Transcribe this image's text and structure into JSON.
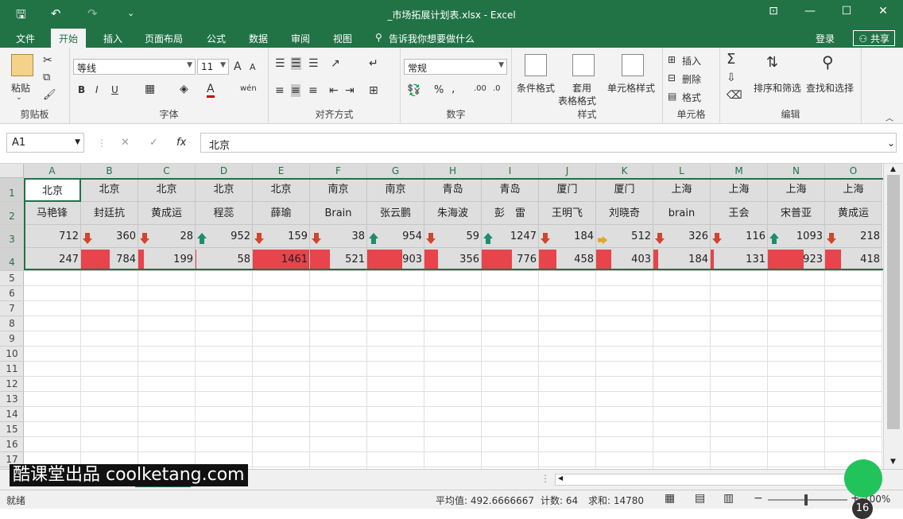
{
  "titlebar": {
    "title": "_市场拓展计划表.xlsx - Excel",
    "save": "🖫",
    "undo": "↶",
    "redo": "↷",
    "more": "⌄",
    "ribbon_opts": "⊡",
    "minimize": "—",
    "restore": "☐",
    "close": "✕"
  },
  "tabs": [
    {
      "label": "文件"
    },
    {
      "label": "开始"
    },
    {
      "label": "插入"
    },
    {
      "label": "页面布局"
    },
    {
      "label": "公式"
    },
    {
      "label": "数据"
    },
    {
      "label": "审阅"
    },
    {
      "label": "视图"
    },
    {
      "label": "告诉我你想要做什么"
    }
  ],
  "account": {
    "login": "登录",
    "share": "共享"
  },
  "ribbon": {
    "clipboard": {
      "label": "剪贴板",
      "paste": "粘贴"
    },
    "font": {
      "label": "字体",
      "name": "等线",
      "size": "11",
      "bold": "B",
      "italic": "I",
      "underline": "U",
      "grow": "A",
      "shrink": "A",
      "wen": "wén"
    },
    "align": {
      "label": "对齐方式"
    },
    "number": {
      "label": "数字",
      "format": "常规",
      "percent": "%",
      "comma": ","
    },
    "styles": {
      "label": "样式",
      "cond": "条件格式",
      "table1": "套用",
      "table2": "表格格式",
      "cell": "单元格样式"
    },
    "cells": {
      "label": "单元格",
      "insert": "插入",
      "delete": "删除",
      "format": "格式"
    },
    "edit": {
      "label": "编辑",
      "sort": "排序和筛选",
      "find": "查找和选择"
    }
  },
  "formula_bar": {
    "namebox": "A1",
    "cancel": "✕",
    "confirm": "✓",
    "fx": "fx",
    "value": "北京"
  },
  "columns": [
    "A",
    "B",
    "C",
    "D",
    "E",
    "F",
    "G",
    "H",
    "I",
    "J",
    "K",
    "L",
    "M",
    "N",
    "O"
  ],
  "rows": [
    "1",
    "2",
    "3",
    "4",
    "5",
    "6",
    "7",
    "8",
    "9",
    "10",
    "11",
    "12",
    "13",
    "14",
    "15",
    "16",
    "17"
  ],
  "table": {
    "row1": [
      "北京",
      "北京",
      "北京",
      "北京",
      "北京",
      "南京",
      "南京",
      "青岛",
      "青岛",
      "厦门",
      "厦门",
      "上海",
      "上海",
      "上海",
      "上海"
    ],
    "row2": [
      "马艳锋",
      "封廷抗",
      "黄成运",
      "程蕊",
      "薛瑜",
      "Brain",
      "张云鹏",
      "朱海波",
      "彭　雷",
      "王明飞",
      "刘晓奇",
      "brain",
      "王会",
      "宋普亚",
      "黄成运"
    ],
    "row3": [
      {
        "v": "712",
        "a": ""
      },
      {
        "v": "360",
        "a": "down"
      },
      {
        "v": "28",
        "a": "down"
      },
      {
        "v": "952",
        "a": "up"
      },
      {
        "v": "159",
        "a": "down"
      },
      {
        "v": "38",
        "a": "down"
      },
      {
        "v": "954",
        "a": "up"
      },
      {
        "v": "59",
        "a": "down"
      },
      {
        "v": "1247",
        "a": "up"
      },
      {
        "v": "184",
        "a": "down"
      },
      {
        "v": "512",
        "a": "right"
      },
      {
        "v": "326",
        "a": "down"
      },
      {
        "v": "116",
        "a": "down"
      },
      {
        "v": "1093",
        "a": "up"
      },
      {
        "v": "218",
        "a": "down"
      }
    ],
    "row4": [
      {
        "v": "247",
        "f": 0.0
      },
      {
        "v": "784",
        "f": 0.5
      },
      {
        "v": "199",
        "f": 0.1
      },
      {
        "v": "58",
        "f": 0.02
      },
      {
        "v": "1461",
        "f": 1.0
      },
      {
        "v": "521",
        "f": 0.35
      },
      {
        "v": "903",
        "f": 0.62
      },
      {
        "v": "356",
        "f": 0.24
      },
      {
        "v": "776",
        "f": 0.53
      },
      {
        "v": "458",
        "f": 0.31
      },
      {
        "v": "403",
        "f": 0.27
      },
      {
        "v": "184",
        "f": 0.09
      },
      {
        "v": "131",
        "f": 0.06
      },
      {
        "v": "923",
        "f": 0.63
      },
      {
        "v": "418",
        "f": 0.28
      }
    ]
  },
  "colors": {
    "accent": "#217346",
    "bar": "#e7444c",
    "up": "#1f8c6e",
    "down": "#d2452b",
    "side": "#e0a826"
  },
  "statusbar": {
    "ready": "就绪",
    "average": "平均值: 492.6666667",
    "count": "计数: 64",
    "sum": "求和: 14780",
    "zoom": "100%"
  },
  "watermark": "酷课堂出品 coolketang.com",
  "badge": "16"
}
